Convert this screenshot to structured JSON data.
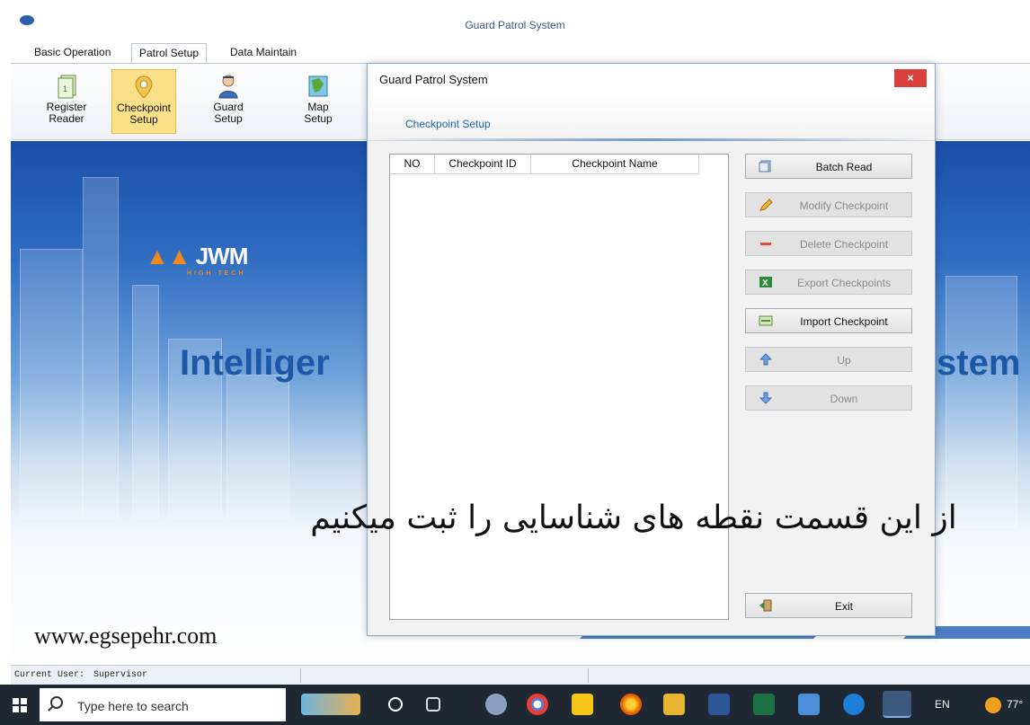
{
  "main_window": {
    "title": "Guard Patrol System",
    "tabs": [
      {
        "label": "Basic Operation"
      },
      {
        "label": "Patrol Setup"
      },
      {
        "label": "Data Maintain"
      }
    ],
    "ribbon": [
      {
        "label": "Register\nReader",
        "icon": "reader-icon"
      },
      {
        "label": "Checkpoint\nSetup",
        "icon": "checkpoint-pin-icon"
      },
      {
        "label": "Guard\nSetup",
        "icon": "guard-person-icon"
      },
      {
        "label": "Map\nSetup",
        "icon": "map-icon"
      }
    ],
    "banner": {
      "logo": "JWM",
      "logo_sub": "HIGH TECH",
      "title_left": "Intelliger",
      "title_right": "stem",
      "website": "www.egsepehr.com"
    },
    "status": {
      "user_label": "Current User:",
      "user_value": "Supervisor"
    }
  },
  "dialog": {
    "title": "Guard Patrol System",
    "close_symbol": "×",
    "header": "Checkpoint Setup",
    "table": {
      "columns": [
        "NO",
        "Checkpoint ID",
        "Checkpoint Name"
      ],
      "rows": []
    },
    "buttons": [
      {
        "label": "Batch Read",
        "enabled": true,
        "icon": "batch-read-icon"
      },
      {
        "label": "Modify Checkpoint",
        "enabled": false,
        "icon": "pencil-icon"
      },
      {
        "label": "Delete Checkpoint",
        "enabled": false,
        "icon": "minus-icon"
      },
      {
        "label": "Export Checkpoints",
        "enabled": false,
        "icon": "excel-icon"
      },
      {
        "label": "Import Checkpoint",
        "enabled": true,
        "icon": "import-icon"
      },
      {
        "label": "Up",
        "enabled": false,
        "icon": "arrow-up-icon"
      },
      {
        "label": "Down",
        "enabled": false,
        "icon": "arrow-down-icon"
      }
    ],
    "exit_label": "Exit"
  },
  "caption": "از این قسمت نقطه های شناسایی را ثبت میکنیم",
  "taskbar": {
    "search_placeholder": "Type here to search",
    "language": "EN",
    "weather": "77°"
  },
  "colors": {
    "ribbon_active": "#fbe08a",
    "close_button": "#d9403a",
    "header_text": "#1f63b0",
    "banner_title": "#1c58a6",
    "logo_accent": "#f08a1c"
  }
}
